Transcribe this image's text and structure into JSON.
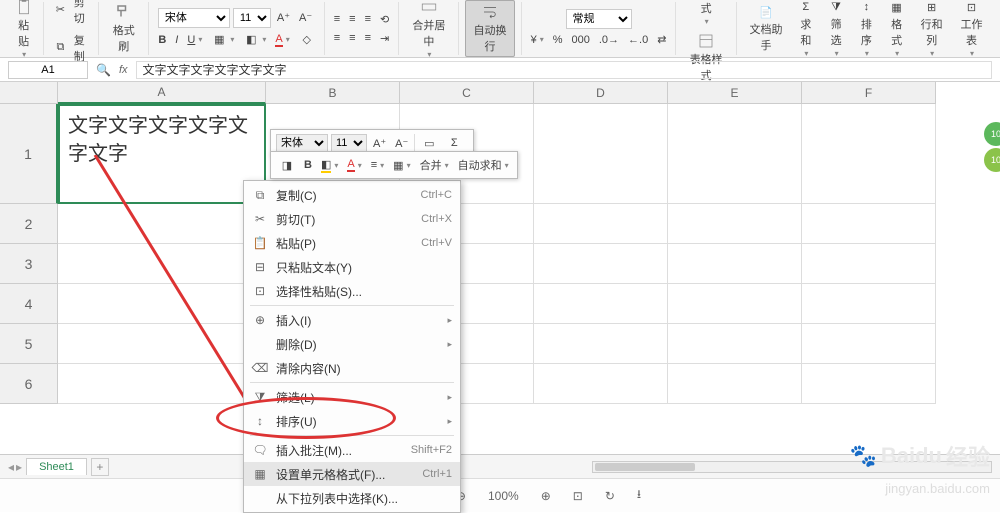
{
  "ribbon": {
    "paste": "粘贴",
    "cut": "剪切",
    "copy": "复制",
    "formatpainter": "格式刷",
    "font": "宋体",
    "size": "11",
    "bold": "B",
    "italic": "I",
    "underline": "U",
    "merge_center": "合并居中",
    "autowrap": "自动换行",
    "numfmt": "常规",
    "condfmt": "条件格式",
    "tablestyle": "表格样式",
    "docasst": "文档助手",
    "sum": "求和",
    "filter": "筛选",
    "sort": "排序",
    "format": "格式",
    "rowcol": "行和列",
    "worksheet": "工作表"
  },
  "namebox": {
    "cell": "A1",
    "formula": "文字文字文字文字文字文字"
  },
  "columns": [
    "A",
    "B",
    "C",
    "D",
    "E",
    "F"
  ],
  "rows": [
    "1",
    "2",
    "3",
    "4",
    "5",
    "6"
  ],
  "cellA1": "文字文字文字文字文字文字",
  "mini": {
    "font": "宋体",
    "size": "11",
    "merge": "合并",
    "autosum": "自动求和"
  },
  "menu": {
    "copy": {
      "l": "复制(C)",
      "s": "Ctrl+C"
    },
    "cut": {
      "l": "剪切(T)",
      "s": "Ctrl+X"
    },
    "paste": {
      "l": "粘贴(P)",
      "s": "Ctrl+V"
    },
    "pastetext": {
      "l": "只粘贴文本(Y)"
    },
    "pastespecial": {
      "l": "选择性粘贴(S)..."
    },
    "insert": {
      "l": "插入(I)"
    },
    "delete": {
      "l": "删除(D)"
    },
    "clear": {
      "l": "清除内容(N)"
    },
    "filter": {
      "l": "筛选(L)"
    },
    "sort": {
      "l": "排序(U)"
    },
    "comment": {
      "l": "插入批注(M)...",
      "s": "Shift+F2"
    },
    "cellformat": {
      "l": "设置单元格格式(F)...",
      "s": "Ctrl+1"
    },
    "dropdown": {
      "l": "从下拉列表中选择(K)..."
    }
  },
  "tab": "Sheet1",
  "zoom": "100%",
  "wm": "经验",
  "wm2": "jingyan.baidu.com"
}
